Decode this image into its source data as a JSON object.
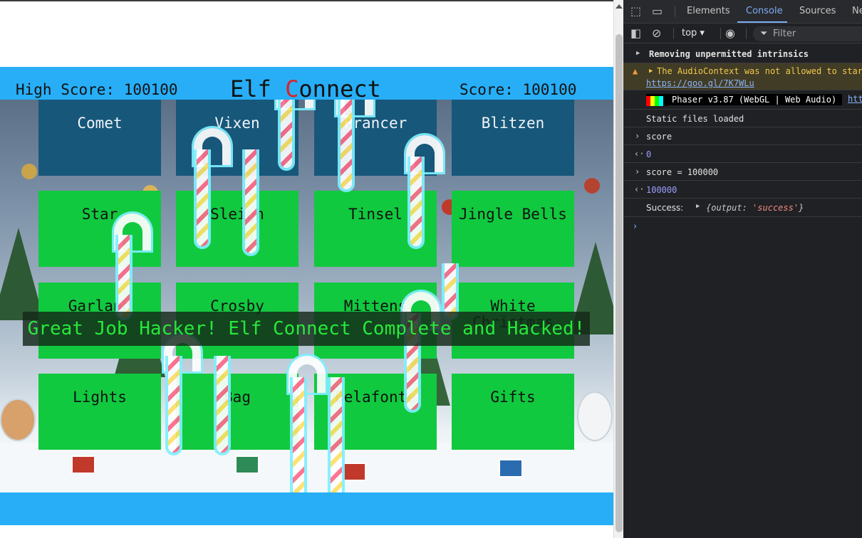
{
  "game": {
    "high_score_label": "High Score: 100100",
    "score_label": "Score: 100100",
    "title_part1": "Elf ",
    "title_part2": "C",
    "title_part3": "onnect",
    "banner": "Great Job Hacker! Elf Connect Complete and Hacked!",
    "tiles": [
      [
        "Comet",
        "Vixen",
        "Prancer",
        "Blitzen"
      ],
      [
        "Star",
        "Sleigh",
        "Tinsel",
        "Jingle Bells"
      ],
      [
        "Garland",
        "Crosby",
        "Mittens",
        "White Christmas"
      ],
      [
        "Lights",
        "Bag",
        "Belafonte",
        "Gifts"
      ]
    ],
    "colors": {
      "blue_tile": "#17577a",
      "green_tile": "#11c93f",
      "frame": "#27aef7",
      "banner_text": "#27e83a"
    }
  },
  "devtools": {
    "tabs": [
      "Elements",
      "Console",
      "Sources",
      "Ne"
    ],
    "active_tab": "Console",
    "context": "top ▾",
    "filter_placeholder": "Filter",
    "icons": [
      "inspect-icon",
      "device-toolbar-icon",
      "sidebar-icon",
      "clear-console-icon",
      "eye-icon",
      "filter-icon"
    ],
    "console": {
      "line1": "Removing unpermitted intrinsics",
      "warning_text": "The AudioContext was not allowed to star",
      "warning_link": "https://goo.gl/7K7WLu",
      "phaser": "Phaser v3.87 (WebGL | Web Audio)",
      "phaser_link": "htt",
      "static": "Static files loaded",
      "in1": "score",
      "out1": "0",
      "in2": "score = 100000",
      "out2": "100000",
      "success_prefix": "Success:",
      "success_obj_open": "{",
      "success_key": "output:",
      "success_value": "'success'",
      "success_obj_close": "}"
    }
  }
}
